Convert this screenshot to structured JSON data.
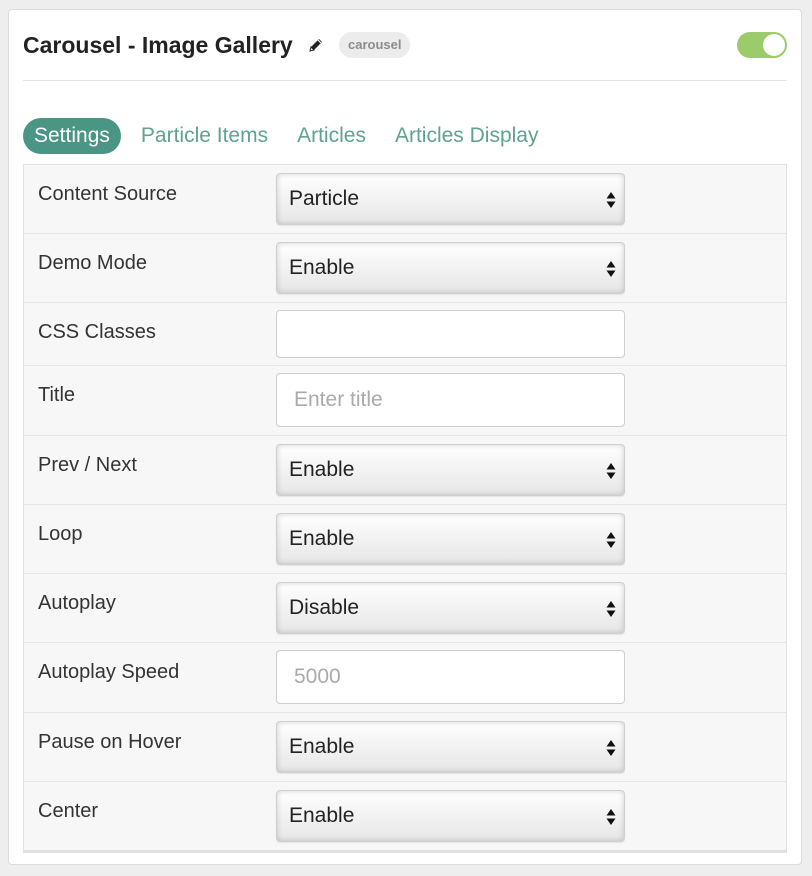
{
  "particle": {
    "title": "Carousel - Image Gallery",
    "badge": "carousel",
    "enabled": true
  },
  "tabs": [
    {
      "label": "Settings",
      "active": true
    },
    {
      "label": "Particle Items",
      "active": false
    },
    {
      "label": "Articles",
      "active": false
    },
    {
      "label": "Articles Display",
      "active": false
    }
  ],
  "fields": {
    "content_source": {
      "label": "Content Source",
      "value": "Particle"
    },
    "demo_mode": {
      "label": "Demo Mode",
      "value": "Enable"
    },
    "css_classes": {
      "label": "CSS Classes",
      "value": "",
      "placeholder": ""
    },
    "title": {
      "label": "Title",
      "value": "",
      "placeholder": "Enter title"
    },
    "prev_next": {
      "label": "Prev / Next",
      "value": "Enable"
    },
    "loop": {
      "label": "Loop",
      "value": "Enable"
    },
    "autoplay": {
      "label": "Autoplay",
      "value": "Disable"
    },
    "autoplay_speed": {
      "label": "Autoplay Speed",
      "value": "",
      "placeholder": "5000"
    },
    "pause_on_hover": {
      "label": "Pause on Hover",
      "value": "Enable"
    },
    "center": {
      "label": "Center",
      "value": "Enable"
    }
  },
  "colors": {
    "accent": "#4a9583",
    "tab_text": "#5fa28f",
    "toggle_on": "#9bcb6a",
    "row_bg": "#f7f7f7"
  }
}
